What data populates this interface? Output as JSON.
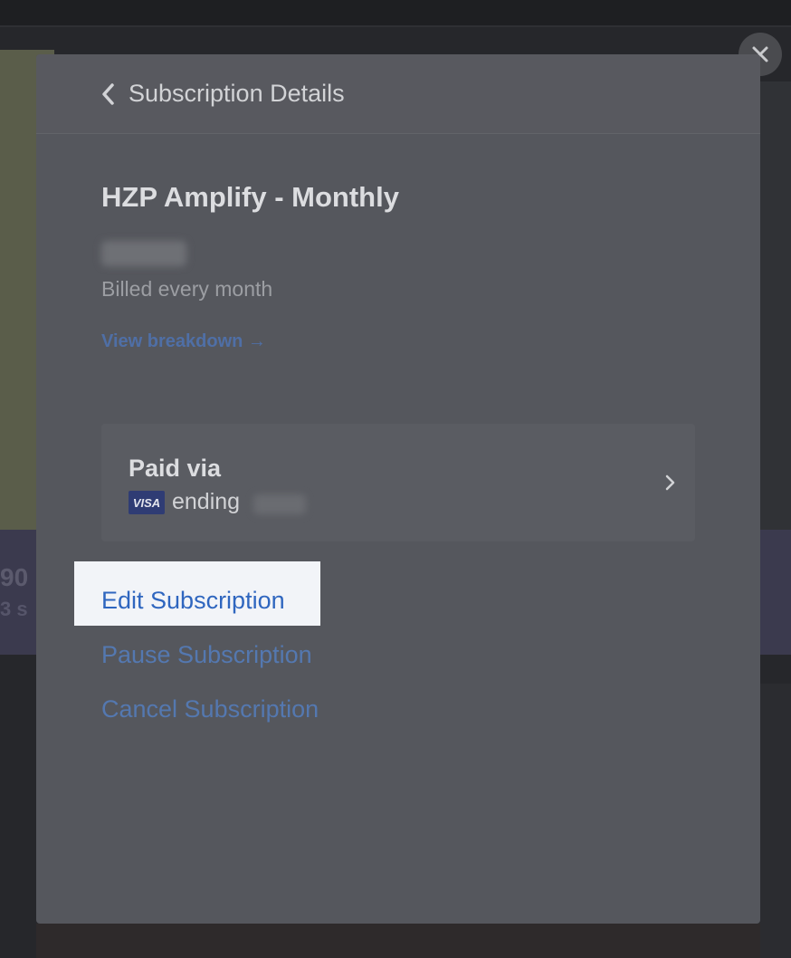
{
  "modal": {
    "title": "Subscription Details",
    "plan_name": "HZP Amplify - Monthly",
    "billing_frequency": "Billed every month",
    "view_breakdown": "View breakdown →"
  },
  "payment": {
    "label": "Paid via",
    "card_brand": "VISA",
    "ending_text": "ending"
  },
  "actions": {
    "edit": "Edit Subscription",
    "pause": "Pause Subscription",
    "cancel": "Cancel Subscription"
  },
  "background": {
    "number_fragment": "90",
    "sub_fragment": "3 s"
  },
  "colors": {
    "link": "#2f66bf",
    "highlight": "#f2f4f8",
    "visa_badge": "#2f3c74"
  },
  "icons": {
    "close": "close-icon",
    "back": "chevron-left-icon",
    "card_arrow": "chevron-right-icon"
  }
}
